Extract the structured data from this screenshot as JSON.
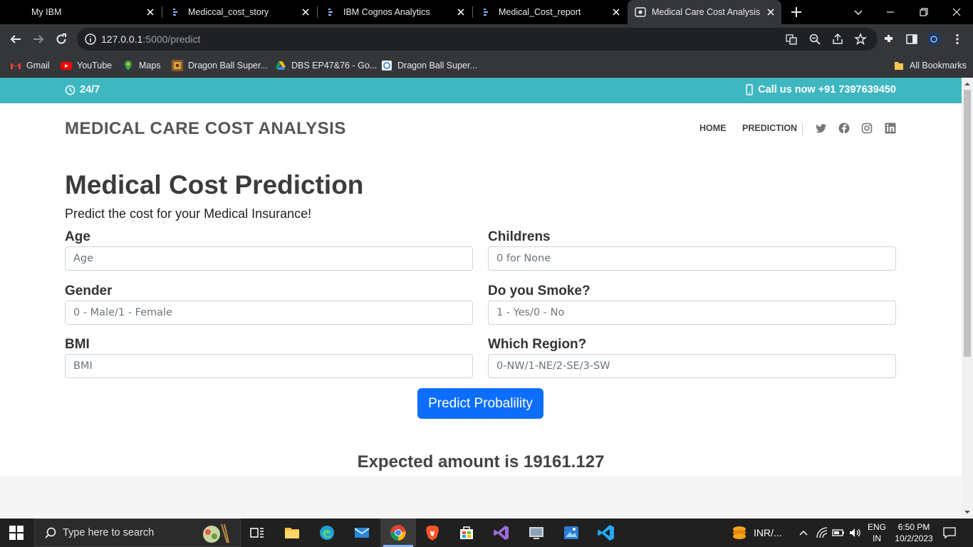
{
  "browser": {
    "tabs": [
      {
        "title": "My IBM",
        "icon": "ibm-icon",
        "active": false
      },
      {
        "title": "Mediccal_cost_story",
        "icon": "cognos-icon",
        "active": false
      },
      {
        "title": "IBM Cognos Analytics",
        "icon": "cognos-icon",
        "active": false
      },
      {
        "title": "Medical_Cost_report",
        "icon": "cognos-icon",
        "active": false
      },
      {
        "title": "Medical Care Cost Analysis",
        "icon": "site-icon",
        "active": true
      }
    ],
    "url_host": "127.0.0.1",
    "url_path": ":5000/predict",
    "bookmarks": [
      {
        "label": "Gmail",
        "icon": "gmail-icon"
      },
      {
        "label": "YouTube",
        "icon": "youtube-icon"
      },
      {
        "label": "Maps",
        "icon": "maps-icon"
      },
      {
        "label": "Dragon Ball Super...",
        "icon": "dragonball-icon"
      },
      {
        "label": "DBS EP47&76 - Go...",
        "icon": "drive-icon"
      },
      {
        "label": "Dragon Ball Super...",
        "icon": "site-icon"
      }
    ],
    "all_bookmarks": "All Bookmarks"
  },
  "site": {
    "topbar": {
      "hours": "24/7",
      "phone": "Call us now +91 7397639450",
      "color": "#3fb7c1"
    },
    "brand": "MEDICAL CARE COST ANALYSIS",
    "nav": [
      {
        "label": "HOME"
      },
      {
        "label": "PREDICTION"
      }
    ],
    "social": [
      "twitter-icon",
      "facebook-icon",
      "instagram-icon",
      "linkedin-icon"
    ]
  },
  "form": {
    "title": "Medical Cost Prediction",
    "subtitle": "Predict the cost for your Medical Insurance!",
    "fields": {
      "age": {
        "label": "Age",
        "placeholder": "Age"
      },
      "childrens": {
        "label": "Childrens",
        "placeholder": "0 for None"
      },
      "gender": {
        "label": "Gender",
        "placeholder": "0 - Male/1 - Female"
      },
      "smoke": {
        "label": "Do you Smoke?",
        "placeholder": "1 - Yes/0 - No"
      },
      "bmi": {
        "label": "BMI",
        "placeholder": "BMI"
      },
      "region": {
        "label": "Which Region?",
        "placeholder": "0-NW/1-NE/2-SE/3-SW"
      }
    },
    "button": "Predict Probalility",
    "button_color": "#0d6efd",
    "result": "Expected amount is 19161.127"
  },
  "taskbar": {
    "search_placeholder": "Type here to search",
    "currency": "INR/...",
    "lang": "ENG",
    "region": "IN",
    "time": "6:50 PM",
    "date": "10/2/2023"
  }
}
